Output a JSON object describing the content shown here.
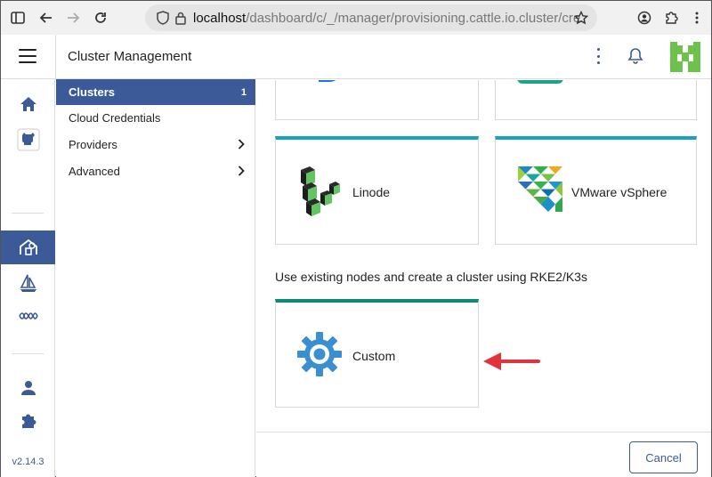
{
  "browser": {
    "url_host": "localhost",
    "url_path": "/dashboard/c/_/manager/provisioning.cattle.io.cluster/cre"
  },
  "header": {
    "title": "Cluster Management"
  },
  "subnav": {
    "items": [
      {
        "label": "Clusters",
        "count": "1"
      },
      {
        "label": "Cloud Credentials"
      },
      {
        "label": "Providers"
      },
      {
        "label": "Advanced"
      }
    ]
  },
  "rail": {
    "version": "v2.14.3"
  },
  "main": {
    "cards": [
      {
        "label": "Linode",
        "icon": "linode-icon"
      },
      {
        "label": "VMware vSphere",
        "icon": "vmware-icon"
      }
    ],
    "section_title": "Use existing nodes and create a cluster using RKE2/K3s",
    "custom_card": {
      "label": "Custom",
      "icon": "gear-icon"
    },
    "cancel_label": "Cancel"
  },
  "colors": {
    "accent": "#3d5a98",
    "card_top": "#1ba1c4",
    "custom_top": "#0c8a77",
    "arrow": "#e0333c"
  }
}
